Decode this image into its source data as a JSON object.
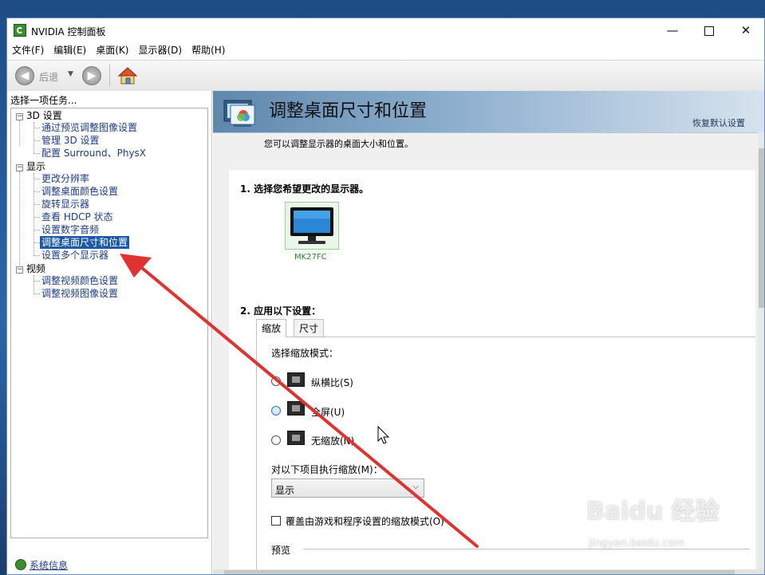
{
  "window": {
    "title": "NVIDIA 控制面板",
    "minimize": "—",
    "close": "✕"
  },
  "menu": [
    "文件(F)",
    "编辑(E)",
    "桌面(K)",
    "显示器(D)",
    "帮助(H)"
  ],
  "toolbar": {
    "back_label": "后退",
    "dropdown": "▼",
    "back_icon": "arrow-left-icon",
    "forward_icon": "arrow-right-icon",
    "home_icon": "home-icon"
  },
  "left": {
    "title": "选择一项任务...",
    "groups": [
      {
        "label": "3D 设置",
        "children": [
          "通过预览调整图像设置",
          "管理 3D 设置",
          "配置 Surround、PhysX"
        ]
      },
      {
        "label": "显示",
        "children": [
          "更改分辨率",
          "调整桌面颜色设置",
          "旋转显示器",
          "查看 HDCP 状态",
          "设置数字音频",
          "调整桌面尺寸和位置",
          "设置多个显示器"
        ]
      },
      {
        "label": "视频",
        "children": [
          "调整视频颜色设置",
          "调整视频图像设置"
        ]
      }
    ],
    "selected": "调整桌面尺寸和位置",
    "system_info": "系统信息"
  },
  "right": {
    "title": "调整桌面尺寸和位置",
    "restore": "恢复默认设置",
    "description": "您可以调整显示器的桌面大小和位置。",
    "step1": "1. 选择您希望更改的显示器。",
    "monitor_name": "MK27FC",
    "step2": "2. 应用以下设置：",
    "tabs": [
      "缩放",
      "尺寸"
    ],
    "active_tab": "缩放",
    "scale_mode_label": "选择缩放模式：",
    "options": [
      "纵横比(S)",
      "全屏(U)",
      "无缩放(N)"
    ],
    "perform_label": "对以下项目执行缩放(M)：",
    "perform_value": "显示",
    "override_label": "覆盖由游戏和程序设置的缩放模式(O)",
    "override_checked": false,
    "preview_label": "预览"
  },
  "watermark": {
    "brand": "Baidu 经验",
    "url": "jingyan.baidu.com"
  },
  "colors": {
    "arrow": "#e0322e",
    "selection": "#1a58a8",
    "nvidia_green": "#3a8f2d"
  }
}
